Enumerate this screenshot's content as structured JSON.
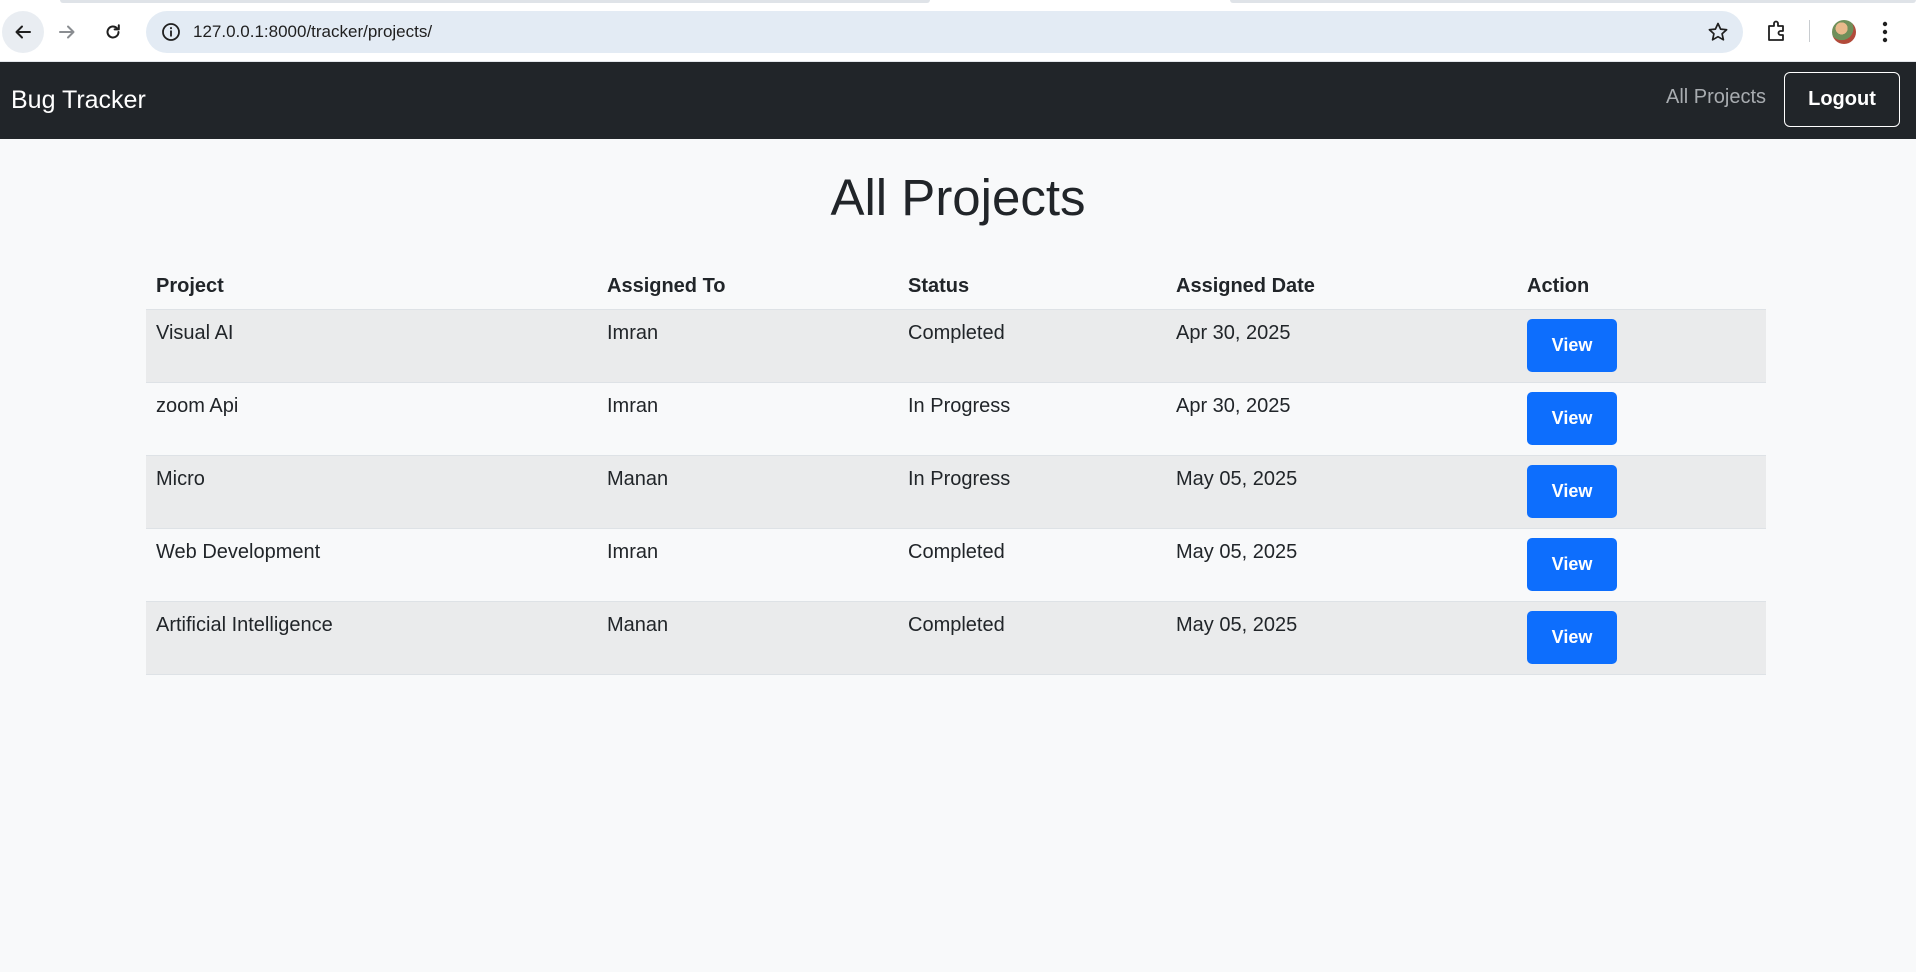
{
  "browser": {
    "url": "127.0.0.1:8000/tracker/projects/"
  },
  "navbar": {
    "brand": "Bug Tracker",
    "nav_link": "All Projects",
    "logout_label": "Logout",
    "bg_color": "#212529"
  },
  "page": {
    "title": "All Projects"
  },
  "table": {
    "headers": [
      "Project",
      "Assigned To",
      "Status",
      "Assigned Date",
      "Action"
    ],
    "rows": [
      {
        "project": "Visual AI",
        "assigned_to": "Imran",
        "status": "Completed",
        "assigned_date": "Apr 30, 2025",
        "action": "View"
      },
      {
        "project": "zoom Api",
        "assigned_to": "Imran",
        "status": "In Progress",
        "assigned_date": "Apr 30, 2025",
        "action": "View"
      },
      {
        "project": "Micro",
        "assigned_to": "Manan",
        "status": "In Progress",
        "assigned_date": "May 05, 2025",
        "action": "View"
      },
      {
        "project": "Web Development",
        "assigned_to": "Imran",
        "status": "Completed",
        "assigned_date": "May 05, 2025",
        "action": "View"
      },
      {
        "project": "Artificial Intelligence",
        "assigned_to": "Manan",
        "status": "Completed",
        "assigned_date": "May 05, 2025",
        "action": "View"
      }
    ]
  },
  "colors": {
    "button_primary": "#0d6efd",
    "page_bg": "#f8f9fa",
    "striped_row": "#eaebec"
  },
  "icons": [
    "back-arrow-icon",
    "forward-arrow-icon",
    "reload-icon",
    "site-info-icon",
    "bookmark-star-icon",
    "extensions-icon",
    "profile-avatar",
    "kebab-menu-icon"
  ]
}
